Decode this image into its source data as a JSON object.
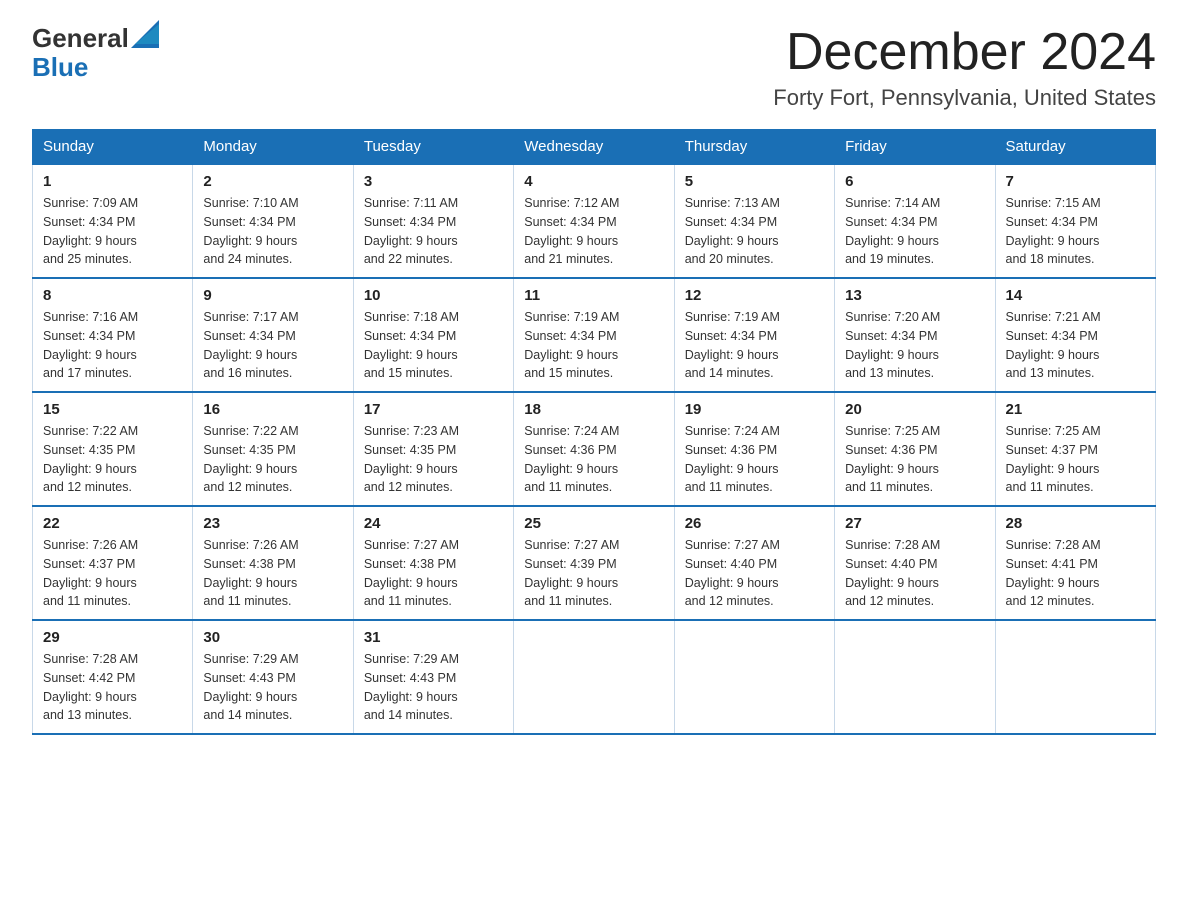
{
  "header": {
    "logo_general": "General",
    "logo_blue": "Blue",
    "month_title": "December 2024",
    "location": "Forty Fort, Pennsylvania, United States"
  },
  "weekdays": [
    "Sunday",
    "Monday",
    "Tuesday",
    "Wednesday",
    "Thursday",
    "Friday",
    "Saturday"
  ],
  "weeks": [
    [
      {
        "day": "1",
        "sunrise": "7:09 AM",
        "sunset": "4:34 PM",
        "daylight": "9 hours and 25 minutes."
      },
      {
        "day": "2",
        "sunrise": "7:10 AM",
        "sunset": "4:34 PM",
        "daylight": "9 hours and 24 minutes."
      },
      {
        "day": "3",
        "sunrise": "7:11 AM",
        "sunset": "4:34 PM",
        "daylight": "9 hours and 22 minutes."
      },
      {
        "day": "4",
        "sunrise": "7:12 AM",
        "sunset": "4:34 PM",
        "daylight": "9 hours and 21 minutes."
      },
      {
        "day": "5",
        "sunrise": "7:13 AM",
        "sunset": "4:34 PM",
        "daylight": "9 hours and 20 minutes."
      },
      {
        "day": "6",
        "sunrise": "7:14 AM",
        "sunset": "4:34 PM",
        "daylight": "9 hours and 19 minutes."
      },
      {
        "day": "7",
        "sunrise": "7:15 AM",
        "sunset": "4:34 PM",
        "daylight": "9 hours and 18 minutes."
      }
    ],
    [
      {
        "day": "8",
        "sunrise": "7:16 AM",
        "sunset": "4:34 PM",
        "daylight": "9 hours and 17 minutes."
      },
      {
        "day": "9",
        "sunrise": "7:17 AM",
        "sunset": "4:34 PM",
        "daylight": "9 hours and 16 minutes."
      },
      {
        "day": "10",
        "sunrise": "7:18 AM",
        "sunset": "4:34 PM",
        "daylight": "9 hours and 15 minutes."
      },
      {
        "day": "11",
        "sunrise": "7:19 AM",
        "sunset": "4:34 PM",
        "daylight": "9 hours and 15 minutes."
      },
      {
        "day": "12",
        "sunrise": "7:19 AM",
        "sunset": "4:34 PM",
        "daylight": "9 hours and 14 minutes."
      },
      {
        "day": "13",
        "sunrise": "7:20 AM",
        "sunset": "4:34 PM",
        "daylight": "9 hours and 13 minutes."
      },
      {
        "day": "14",
        "sunrise": "7:21 AM",
        "sunset": "4:34 PM",
        "daylight": "9 hours and 13 minutes."
      }
    ],
    [
      {
        "day": "15",
        "sunrise": "7:22 AM",
        "sunset": "4:35 PM",
        "daylight": "9 hours and 12 minutes."
      },
      {
        "day": "16",
        "sunrise": "7:22 AM",
        "sunset": "4:35 PM",
        "daylight": "9 hours and 12 minutes."
      },
      {
        "day": "17",
        "sunrise": "7:23 AM",
        "sunset": "4:35 PM",
        "daylight": "9 hours and 12 minutes."
      },
      {
        "day": "18",
        "sunrise": "7:24 AM",
        "sunset": "4:36 PM",
        "daylight": "9 hours and 11 minutes."
      },
      {
        "day": "19",
        "sunrise": "7:24 AM",
        "sunset": "4:36 PM",
        "daylight": "9 hours and 11 minutes."
      },
      {
        "day": "20",
        "sunrise": "7:25 AM",
        "sunset": "4:36 PM",
        "daylight": "9 hours and 11 minutes."
      },
      {
        "day": "21",
        "sunrise": "7:25 AM",
        "sunset": "4:37 PM",
        "daylight": "9 hours and 11 minutes."
      }
    ],
    [
      {
        "day": "22",
        "sunrise": "7:26 AM",
        "sunset": "4:37 PM",
        "daylight": "9 hours and 11 minutes."
      },
      {
        "day": "23",
        "sunrise": "7:26 AM",
        "sunset": "4:38 PM",
        "daylight": "9 hours and 11 minutes."
      },
      {
        "day": "24",
        "sunrise": "7:27 AM",
        "sunset": "4:38 PM",
        "daylight": "9 hours and 11 minutes."
      },
      {
        "day": "25",
        "sunrise": "7:27 AM",
        "sunset": "4:39 PM",
        "daylight": "9 hours and 11 minutes."
      },
      {
        "day": "26",
        "sunrise": "7:27 AM",
        "sunset": "4:40 PM",
        "daylight": "9 hours and 12 minutes."
      },
      {
        "day": "27",
        "sunrise": "7:28 AM",
        "sunset": "4:40 PM",
        "daylight": "9 hours and 12 minutes."
      },
      {
        "day": "28",
        "sunrise": "7:28 AM",
        "sunset": "4:41 PM",
        "daylight": "9 hours and 12 minutes."
      }
    ],
    [
      {
        "day": "29",
        "sunrise": "7:28 AM",
        "sunset": "4:42 PM",
        "daylight": "9 hours and 13 minutes."
      },
      {
        "day": "30",
        "sunrise": "7:29 AM",
        "sunset": "4:43 PM",
        "daylight": "9 hours and 14 minutes."
      },
      {
        "day": "31",
        "sunrise": "7:29 AM",
        "sunset": "4:43 PM",
        "daylight": "9 hours and 14 minutes."
      },
      null,
      null,
      null,
      null
    ]
  ],
  "labels": {
    "sunrise": "Sunrise:",
    "sunset": "Sunset:",
    "daylight": "Daylight:"
  }
}
